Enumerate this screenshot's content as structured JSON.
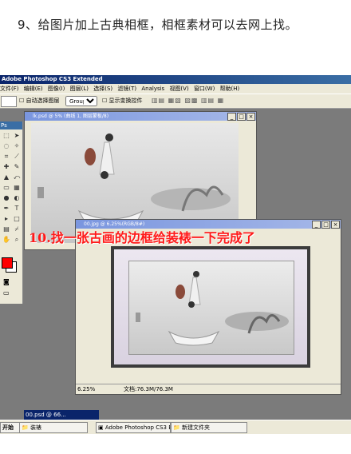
{
  "caption": "9、给图片加上古典相框，相框素材可以去网上找。",
  "app": {
    "title": "Adobe Photoshop CS3 Extended",
    "menu": [
      "文件(F)",
      "编辑(E)",
      "图像(I)",
      "图层(L)",
      "选择(S)",
      "滤镜(T)",
      "Analysis",
      "视图(V)",
      "窗口(W)",
      "帮助(H)"
    ],
    "options": {
      "auto_select": "自动选择图层",
      "group_value": "Group",
      "show_transform": "显示变换控件"
    },
    "toolbox_title": "Ps"
  },
  "doc1": {
    "title": "lk.psd @ 5% (曲线 1, 图层蒙板/8)",
    "zoom": "5%"
  },
  "doc2": {
    "title": "00.jpg @ 6.25%(RGB/8#)",
    "zoom": "6.25%",
    "doc_size": "文档:76.3M/76.3M"
  },
  "overlay_text": "10.找一张古画的边框给装裱一下完成了",
  "minimized": "00.psd @ 66...",
  "taskbar": {
    "start": "开始",
    "items": [
      "装裱",
      "Adobe Photoshop CS3 E...",
      "新建文件夹"
    ]
  }
}
